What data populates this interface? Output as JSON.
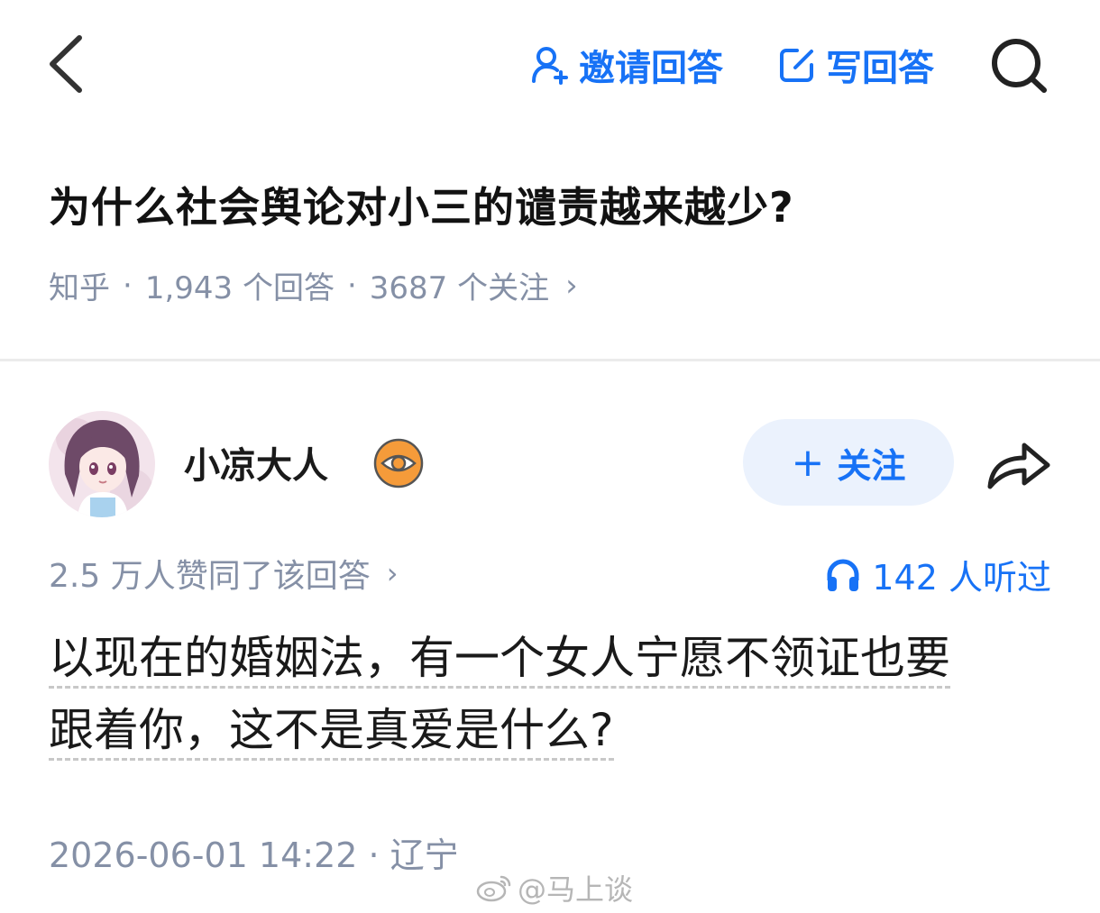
{
  "topbar": {
    "invite_label": "邀请回答",
    "write_label": "写回答"
  },
  "question": {
    "title": "为什么社会舆论对小三的谴责越来越少?",
    "source": "知乎",
    "answers_count": "1,943 个回答",
    "followers_count": "3687 个关注",
    "separator": "·",
    "chevron": "›"
  },
  "author": {
    "name": "小凉大人",
    "follow_label": "关注",
    "follow_plus": "+"
  },
  "stats": {
    "votes_text": "2.5 万人赞同了该回答",
    "chevron": "›",
    "listens_text": "142 人听过"
  },
  "answer": {
    "line1": "以现在的婚姻法，有一个女人宁愿不领证也要",
    "line2": "跟着你，这不是真爱是什么?"
  },
  "footer": {
    "date_location": "2026-06-01 14:22 · 辽宁",
    "watermark": "@马上谈"
  },
  "colors": {
    "accent": "#1772f6",
    "muted": "#8590a6",
    "badge_orange": "#f59b3a",
    "follow_bg": "#ebf2fd"
  },
  "icons": {
    "back": "chevron-left-icon",
    "invite": "person-plus-icon",
    "write": "edit-icon",
    "search": "search-icon",
    "badge": "eye-badge-icon",
    "share": "share-arrow-icon",
    "listens": "headphones-icon",
    "watermark": "weibo-icon"
  }
}
